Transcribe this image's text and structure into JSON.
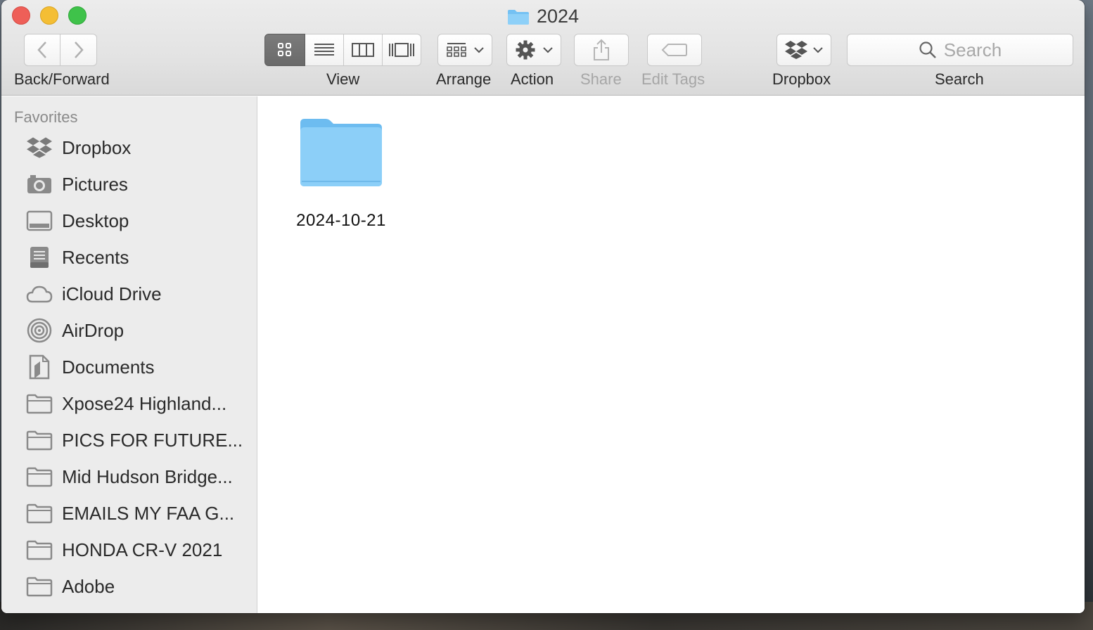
{
  "window": {
    "title": "2024"
  },
  "toolbar": {
    "back_forward_label": "Back/Forward",
    "view_label": "View",
    "arrange_label": "Arrange",
    "action_label": "Action",
    "share_label": "Share",
    "edit_tags_label": "Edit Tags",
    "dropbox_label": "Dropbox",
    "search_label": "Search",
    "search_placeholder": "Search"
  },
  "sidebar": {
    "heading": "Favorites",
    "items": [
      {
        "label": "Dropbox",
        "icon": "dropbox-icon"
      },
      {
        "label": "Pictures",
        "icon": "camera-icon"
      },
      {
        "label": "Desktop",
        "icon": "desktop-icon"
      },
      {
        "label": "Recents",
        "icon": "recents-icon"
      },
      {
        "label": "iCloud Drive",
        "icon": "cloud-icon"
      },
      {
        "label": "AirDrop",
        "icon": "airdrop-icon"
      },
      {
        "label": "Documents",
        "icon": "document-icon"
      },
      {
        "label": "Xpose24 Highland...",
        "icon": "folder-icon"
      },
      {
        "label": "PICS FOR FUTURE...",
        "icon": "folder-icon"
      },
      {
        "label": "Mid Hudson Bridge...",
        "icon": "folder-icon"
      },
      {
        "label": "EMAILS MY FAA G...",
        "icon": "folder-icon"
      },
      {
        "label": "HONDA CR-V 2021",
        "icon": "folder-icon"
      },
      {
        "label": "Adobe",
        "icon": "folder-icon"
      }
    ]
  },
  "content": {
    "files": [
      {
        "name": "2024-10-21",
        "kind": "folder"
      }
    ]
  },
  "colors": {
    "folder_blue": "#7cc8f6",
    "close": "#ee5f58",
    "minimize": "#f4be34",
    "maximize": "#3fc24a"
  }
}
